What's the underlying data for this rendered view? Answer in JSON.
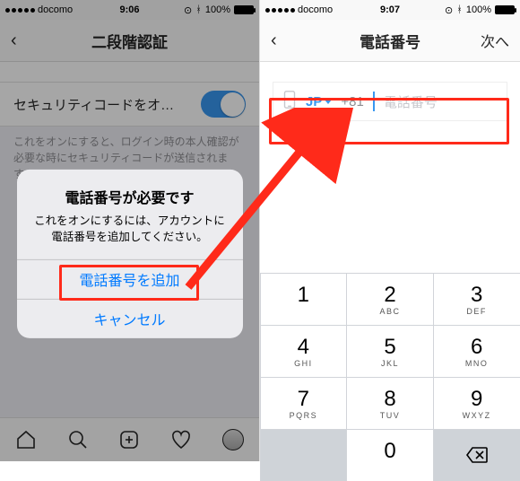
{
  "left": {
    "status": {
      "carrier": "docomo",
      "time": "9:06",
      "battery": "100%"
    },
    "nav": {
      "title": "二段階認証"
    },
    "row": {
      "label": "セキュリティコードをオン…"
    },
    "hint": "これをオンにすると、ログイン時の本人確認が必要な時にセキュリティコードが送信されます。",
    "alert": {
      "title": "電話番号が必要です",
      "message": "これをオンにするには、アカウントに電話番号を追加してください。",
      "add": "電話番号を追加",
      "cancel": "キャンセル"
    }
  },
  "right": {
    "status": {
      "carrier": "docomo",
      "time": "9:07",
      "battery": "100%"
    },
    "nav": {
      "title": "電話番号",
      "next": "次へ"
    },
    "field": {
      "country": "JP",
      "prefix": "+81",
      "placeholder": "電話番号"
    },
    "keypad": {
      "keys": [
        [
          {
            "num": "1",
            "sub": ""
          },
          {
            "num": "2",
            "sub": "ABC"
          },
          {
            "num": "3",
            "sub": "DEF"
          }
        ],
        [
          {
            "num": "4",
            "sub": "GHI"
          },
          {
            "num": "5",
            "sub": "JKL"
          },
          {
            "num": "6",
            "sub": "MNO"
          }
        ],
        [
          {
            "num": "7",
            "sub": "PQRS"
          },
          {
            "num": "8",
            "sub": "TUV"
          },
          {
            "num": "9",
            "sub": "WXYZ"
          }
        ],
        [
          {
            "num": "",
            "sub": "",
            "func": "blank"
          },
          {
            "num": "0",
            "sub": ""
          },
          {
            "num": "",
            "sub": "",
            "func": "delete"
          }
        ]
      ]
    }
  }
}
